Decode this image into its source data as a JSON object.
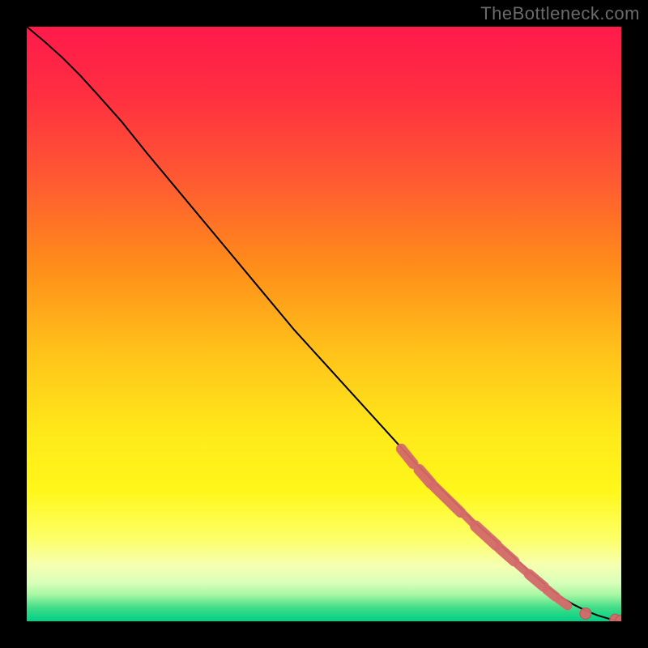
{
  "watermark": "TheBottleneck.com",
  "colors": {
    "frame": "#000000",
    "curve": "#000000",
    "marker_fill": "#d46a6a",
    "marker_stroke": "#b55555"
  },
  "gradient_stops": [
    {
      "offset": 0.0,
      "color": "#ff1a4b"
    },
    {
      "offset": 0.12,
      "color": "#ff3040"
    },
    {
      "offset": 0.25,
      "color": "#ff5733"
    },
    {
      "offset": 0.4,
      "color": "#ff8c1a"
    },
    {
      "offset": 0.55,
      "color": "#ffc31a"
    },
    {
      "offset": 0.68,
      "color": "#ffe81a"
    },
    {
      "offset": 0.78,
      "color": "#fff71a"
    },
    {
      "offset": 0.86,
      "color": "#fdff66"
    },
    {
      "offset": 0.905,
      "color": "#f6ffb0"
    },
    {
      "offset": 0.935,
      "color": "#d9ffba"
    },
    {
      "offset": 0.955,
      "color": "#a8f7a3"
    },
    {
      "offset": 0.978,
      "color": "#3edc87"
    },
    {
      "offset": 1.0,
      "color": "#00d084"
    }
  ],
  "chart_data": {
    "type": "line",
    "title": "",
    "xlabel": "",
    "ylabel": "",
    "xlim": [
      0,
      100
    ],
    "ylim": [
      0,
      100
    ],
    "series": [
      {
        "name": "curve",
        "x": [
          0,
          3,
          6,
          9,
          12,
          16,
          20,
          25,
          30,
          35,
          40,
          45,
          50,
          55,
          60,
          65,
          70,
          75,
          80,
          85,
          88,
          90,
          92,
          94,
          96,
          98,
          100
        ],
        "y": [
          100,
          97.5,
          94.8,
          91.8,
          88.5,
          84,
          79,
          73,
          67,
          61,
          55,
          49,
          43.5,
          38,
          32.5,
          27,
          22,
          17,
          12.5,
          8,
          5.5,
          4,
          2.8,
          1.8,
          1.0,
          0.4,
          0.1
        ]
      }
    ],
    "segments": [
      {
        "x0": 63,
        "y0": 29,
        "x1": 65,
        "y1": 26.5,
        "w": 13
      },
      {
        "x0": 66,
        "y0": 25.5,
        "x1": 68,
        "y1": 23.2,
        "w": 14
      },
      {
        "x0": 68.5,
        "y0": 22.7,
        "x1": 73,
        "y1": 18.3,
        "w": 13
      },
      {
        "x0": 73.5,
        "y0": 18,
        "x1": 75,
        "y1": 16.5,
        "w": 10
      },
      {
        "x0": 75.5,
        "y0": 16,
        "x1": 79,
        "y1": 12.8,
        "w": 14
      },
      {
        "x0": 79.5,
        "y0": 12.3,
        "x1": 82,
        "y1": 10.1,
        "w": 13
      },
      {
        "x0": 82.5,
        "y0": 9.6,
        "x1": 84,
        "y1": 8.3,
        "w": 10
      },
      {
        "x0": 84.5,
        "y0": 7.9,
        "x1": 87,
        "y1": 5.8,
        "w": 13
      },
      {
        "x0": 87.5,
        "y0": 5.3,
        "x1": 89,
        "y1": 4.1,
        "w": 12
      },
      {
        "x0": 89.5,
        "y0": 3.7,
        "x1": 91,
        "y1": 2.6,
        "w": 11
      }
    ],
    "markers": [
      {
        "x": 94,
        "y": 1.3,
        "r": 7
      },
      {
        "x": 99,
        "y": 0.25,
        "r": 7
      },
      {
        "x": 100,
        "y": 0.1,
        "r": 7
      }
    ]
  }
}
